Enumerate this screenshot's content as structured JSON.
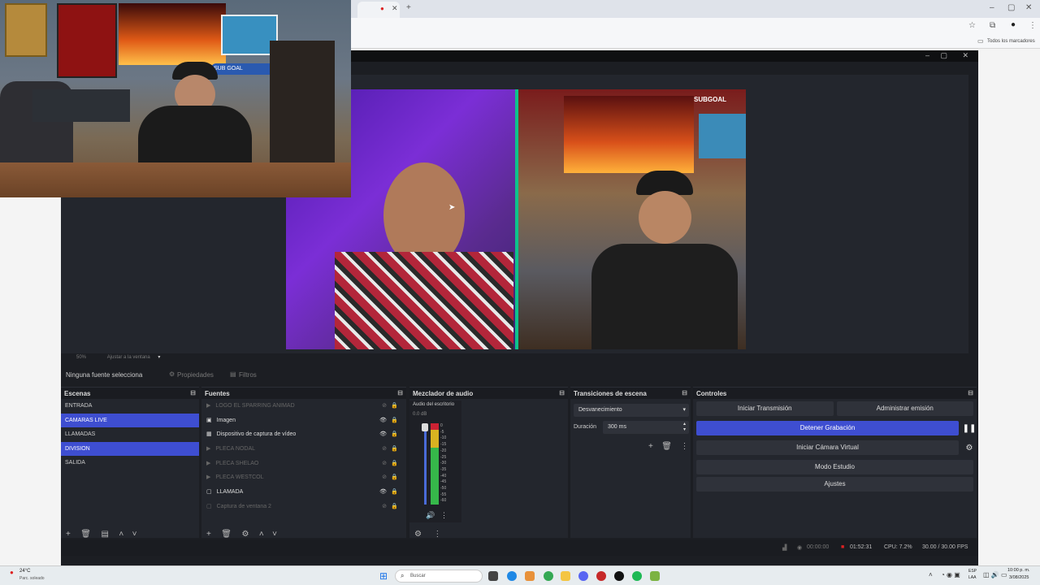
{
  "browser": {
    "bookmarks_label": "Todos los marcadores"
  },
  "webcam": {
    "overlay_text": "SUB GOAL"
  },
  "obs": {
    "preview": {
      "stream_overlay": "SUBGOAL",
      "zoom_text": "50%",
      "fit_text": "Ajustar a la ventana"
    },
    "source_toolbar": {
      "no_source": "Ninguna fuente selecciona",
      "properties": "Propiedades",
      "filters": "Filtros"
    },
    "scenes": {
      "title": "Escenas",
      "items": [
        {
          "label": "ENTRADA",
          "selected": false
        },
        {
          "label": "CAMARAS LIVE",
          "selected": true
        },
        {
          "label": "LLAMADAS",
          "selected": false
        },
        {
          "label": "DIVISION",
          "selected": true
        },
        {
          "label": "SALIDA",
          "selected": false
        }
      ]
    },
    "sources": {
      "title": "Fuentes",
      "items": [
        {
          "label": "LOGO EL SPARRING ANIMAD",
          "icon": "play-icon",
          "visible": false
        },
        {
          "label": "Imagen",
          "icon": "image-icon",
          "visible": true
        },
        {
          "label": "Dispositivo de captura de vídeo",
          "icon": "camera-icon",
          "visible": true
        },
        {
          "label": "PLECA NODAL",
          "icon": "play-icon",
          "visible": false
        },
        {
          "label": "PLECA SHELAO",
          "icon": "play-icon",
          "visible": false
        },
        {
          "label": "PLECA WESTCOL",
          "icon": "play-icon",
          "visible": false
        },
        {
          "label": "LLAMADA",
          "icon": "window-icon",
          "visible": true
        },
        {
          "label": "Captura de ventana 2",
          "icon": "window-icon",
          "visible": false
        }
      ]
    },
    "mixer": {
      "title": "Mezclador de audio",
      "channel": "Audio del escritorio",
      "db": "0.0 dB",
      "ticks": [
        "0",
        "-5",
        "-10",
        "-15",
        "-20",
        "-25",
        "-30",
        "-35",
        "-40",
        "-45",
        "-50",
        "-55",
        "-60"
      ]
    },
    "transitions": {
      "title": "Transiciones de escena",
      "selected": "Desvanecimiento",
      "duration_label": "Duración",
      "duration_value": "300 ms"
    },
    "controls": {
      "title": "Controles",
      "start_stream": "Iniciar Transmisión",
      "manage_broadcast": "Administrar emisión",
      "stop_recording": "Detener Grabación",
      "virtual_camera": "Iniciar Cámara Virtual",
      "studio_mode": "Modo Estudio",
      "settings": "Ajustes"
    },
    "status": {
      "stream_time": "00:00:00",
      "rec_time": "01:52:31",
      "cpu": "CPU: 7.2%",
      "fps": "30.00 / 30.00 FPS"
    }
  },
  "taskbar": {
    "weather_temp": "24°C",
    "weather_desc": "Parc. soleado",
    "search": "Buscar",
    "lang": "ESP",
    "lang2": "LAA",
    "time": "10:00 p. m.",
    "date": "3/08/2025"
  },
  "colors": {
    "accent": "#3e4ed1",
    "green": "#0ec28c",
    "obs_bg": "#1c1e23"
  }
}
